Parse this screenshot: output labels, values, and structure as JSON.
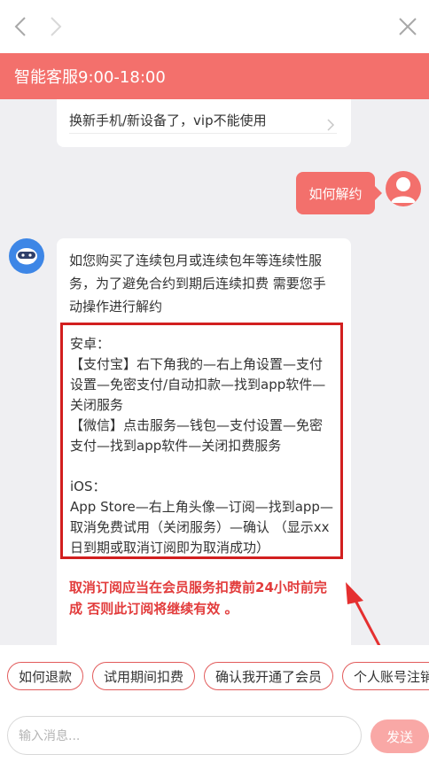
{
  "nav": {
    "back_icon": "chevron-left-icon",
    "forward_icon": "chevron-right-icon",
    "close_icon": "close-icon"
  },
  "service_bar": {
    "text": "智能客服9:00-18:00",
    "color": "#f3706c"
  },
  "chat": {
    "top_card": {
      "item": "换新手机/新设备了，vip不能使用"
    },
    "user_message": "如何解约",
    "bot_message": {
      "intro": "如您购买了连续包月或连续包年等连续性服务，为了避免合约到期后连续扣费 需要您手动操作进行解约",
      "android_title": "安卓：",
      "alipay": "【支付宝】右下角我的—右上角设置—支付设置—免密支付/自动扣款—找到app软件—关闭服务",
      "wechat": "【微信】点击服务—钱包—支付设置—免密支付—找到app软件—关闭扣费服务",
      "ios_title": "iOS：",
      "ios": "App Store—右上角头像—订阅—找到app—取消免费试用（关闭服务）—确认 （显示xx日到期或取消订阅即为取消成功）",
      "warning": "取消订阅应当在会员服务扣费前24小时前完成 否则此订阅将继续有效 。"
    }
  },
  "quick_replies": [
    {
      "label": "如何退款"
    },
    {
      "label": "试用期间扣费"
    },
    {
      "label": "确认我开通了会员"
    },
    {
      "label": "个人账号注销"
    }
  ],
  "input": {
    "placeholder": "输入消息...",
    "send_label": "发送"
  }
}
